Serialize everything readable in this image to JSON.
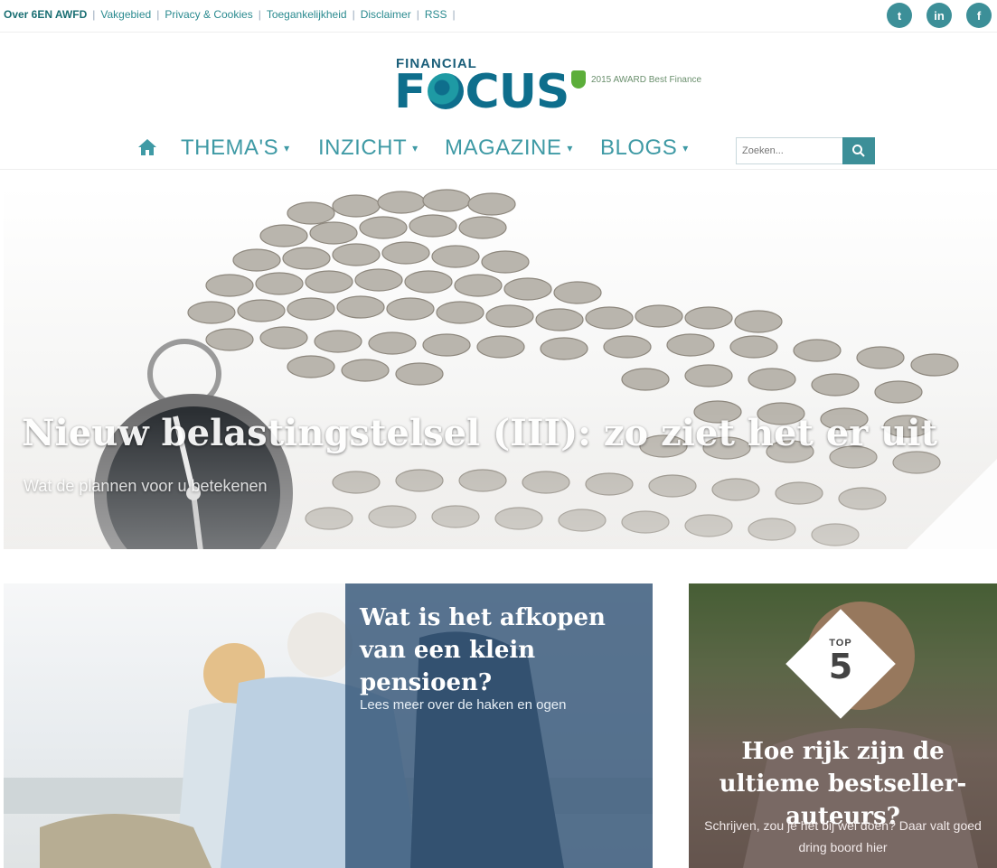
{
  "topbar": {
    "links": [
      "Over 6EN AWFD",
      "Vakgebied",
      "Privacy & Cookies",
      "Toegankelijkheid",
      "Disclaimer",
      "RSS"
    ],
    "social": [
      {
        "icon": "twitter-icon",
        "glyph": "t"
      },
      {
        "icon": "linkedin-icon",
        "glyph": "in"
      },
      {
        "icon": "facebook-icon",
        "glyph": "f"
      }
    ]
  },
  "logo": {
    "small": "FINANCIAL",
    "big_pre": "F",
    "big_post": "CUS",
    "badge": "2015 AWARD Best Finance"
  },
  "nav": {
    "items": [
      "THEMA'S",
      "INZICHT",
      "MAGAZINE",
      "BLOGS"
    ],
    "search_placeholder": "Zoeken..."
  },
  "hero": {
    "title": "Nieuw belastingstelsel (III): zo ziet het er uit",
    "subtitle": "Wat de plannen voor u betekenen"
  },
  "card1": {
    "title": "Wat is het afkopen van een klein pensioen?",
    "subtitle": "Lees meer over de haken en ogen"
  },
  "card2": {
    "badge_top": "TOP",
    "badge_num": "5",
    "title": "Hoe rijk zijn de ultieme bestseller-auteurs?",
    "subtitle": "Schrijven, zou je het bij wel doen? Daar valt goed dring boord hier"
  },
  "colors": {
    "brand": "#0e6e8c",
    "accent": "#3f9aa5",
    "panel": "#345678"
  }
}
